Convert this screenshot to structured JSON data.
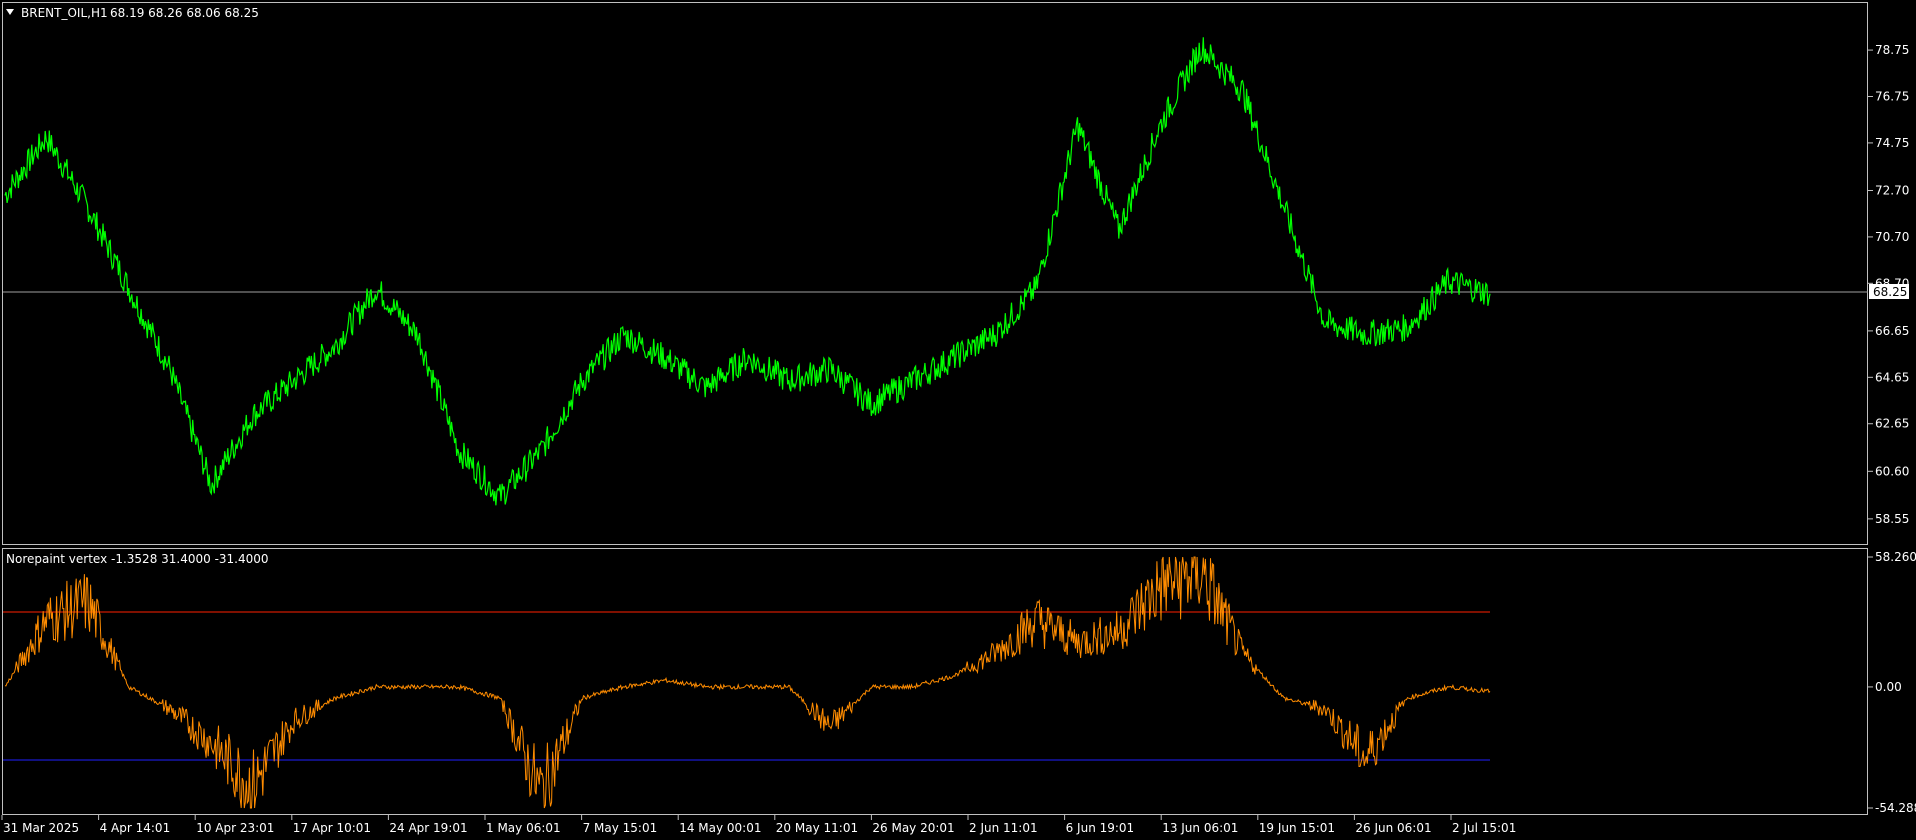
{
  "colors": {
    "background": "#000000",
    "frame": "#c0c0c0",
    "price_line": "#00ff00",
    "osc_line": "#ff8c00",
    "upper_level": "#ff2000",
    "lower_level": "#2020ff",
    "current_price_line": "#a0a0a0"
  },
  "header": {
    "symbol": "BRENT_OIL,H1",
    "ohlc": "68.19 68.26 68.06 68.25",
    "dropdown_icon": "triangle-down-icon"
  },
  "subwindow": {
    "title": "Norepaint vertex -1.3528 31.4000 -31.4000"
  },
  "time_labels": [
    "31 Mar 2025",
    "4 Apr 14:01",
    "10 Apr 23:01",
    "17 Apr 10:01",
    "24 Apr 19:01",
    "1 May 06:01",
    "7 May 15:01",
    "14 May 00:01",
    "20 May 11:01",
    "26 May 20:01",
    "2 Jun 11:01",
    "6 Jun 19:01",
    "13 Jun 06:01",
    "19 Jun 15:01",
    "26 Jun 06:01",
    "2 Jul 15:01"
  ],
  "chart_data": [
    {
      "type": "line",
      "title": "BRENT_OIL,H1",
      "y_ticks": [
        "78.75",
        "76.75",
        "74.75",
        "72.70",
        "70.70",
        "68.70",
        "66.65",
        "64.65",
        "62.65",
        "60.60",
        "58.55"
      ],
      "ylim": [
        58.2,
        79.4
      ],
      "current_price": 68.25,
      "current_price_label": "68.25",
      "x": [
        "31 Mar 2025",
        "4 Apr 14:01",
        "10 Apr 23:01",
        "17 Apr 10:01",
        "24 Apr 19:01",
        "1 May 06:01",
        "7 May 15:01",
        "14 May 00:01",
        "20 May 11:01",
        "26 May 20:01",
        "2 Jun 11:01",
        "6 Jun 19:01",
        "13 Jun 06:01",
        "19 Jun 15:01",
        "26 Jun 06:01",
        "2 Jul 15:01"
      ],
      "series": [
        {
          "values": [
            72.5,
            75.0,
            72.0,
            68.5,
            65.0,
            60.0,
            63.0,
            64.5,
            66.0,
            68.5,
            66.5,
            61.5,
            59.5,
            61.5,
            64.5,
            66.5,
            65.5,
            64.2,
            65.5,
            64.5,
            65.0,
            63.5,
            64.5,
            65.5,
            66.5,
            68.5,
            75.5,
            71.0,
            75.5,
            78.9,
            77.0,
            72.0,
            67.0,
            66.5,
            66.8,
            68.8,
            68.25
          ]
        }
      ]
    },
    {
      "type": "line",
      "title": "Norepaint vertex",
      "y_ticks": [
        "58.2602",
        "0.00",
        "-54.2889"
      ],
      "ylim": [
        -54.2889,
        58.2602
      ],
      "levels": [
        31.4,
        -31.4
      ],
      "series": [
        {
          "values": [
            0,
            30,
            38,
            0,
            -10,
            -25,
            -45,
            -15,
            -5,
            0,
            0,
            0,
            -5,
            -48,
            -5,
            0,
            3,
            0,
            0,
            0,
            -18,
            0,
            0,
            5,
            15,
            30,
            20,
            25,
            45,
            52,
            15,
            -5,
            -10,
            -32,
            -5,
            0,
            -2
          ]
        }
      ]
    }
  ]
}
